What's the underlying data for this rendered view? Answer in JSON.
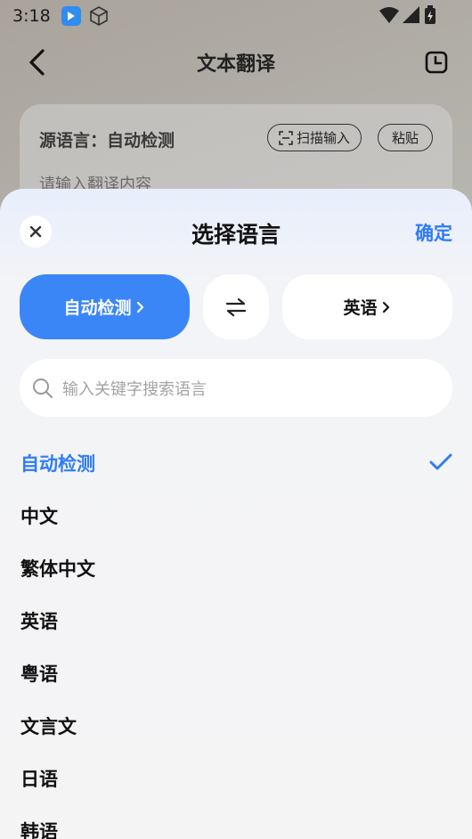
{
  "status_bar": {
    "time": "3:18"
  },
  "header": {
    "title": "文本翻译"
  },
  "source_card": {
    "label": "源语言：自动检测",
    "scan_label": "扫描输入",
    "paste_label": "粘贴",
    "input_placeholder": "请输入翻译内容"
  },
  "sheet": {
    "title": "选择语言",
    "confirm_label": "确定",
    "source_lang": "自动检测",
    "target_lang": "英语",
    "search_placeholder": "输入关键字搜索语言",
    "accent_color": "#2f7cf6",
    "languages": [
      {
        "label": "自动检测",
        "selected": true
      },
      {
        "label": "中文",
        "selected": false
      },
      {
        "label": "繁体中文",
        "selected": false
      },
      {
        "label": "英语",
        "selected": false
      },
      {
        "label": "粤语",
        "selected": false
      },
      {
        "label": "文言文",
        "selected": false
      },
      {
        "label": "日语",
        "selected": false
      },
      {
        "label": "韩语",
        "selected": false
      }
    ]
  }
}
